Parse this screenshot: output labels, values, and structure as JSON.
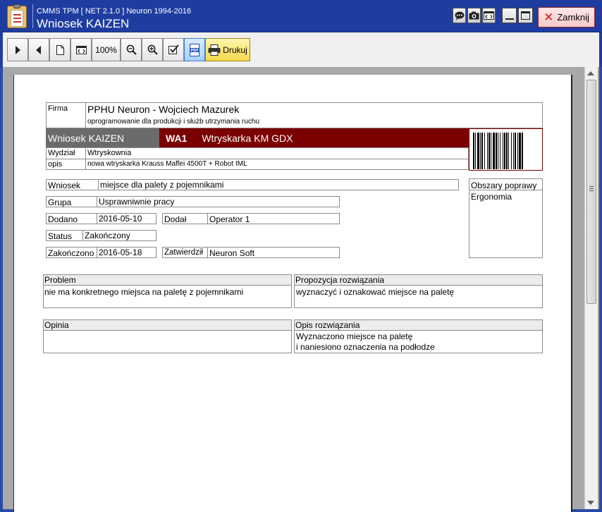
{
  "window": {
    "app_name": "CMMS TPM  [ NET 2.1.0 ]  Neuron 1994-2016",
    "title": "Wniosek KAIZEN",
    "close_label": "Zamknij"
  },
  "toolbar": {
    "zoom_label": "100%",
    "print_label": "Drukuj"
  },
  "report": {
    "firma_label": "Firma",
    "firma_name": "PPHU Neuron - Wojciech Mazurek",
    "firma_desc": "oprogramowanie dla produkcji i służb utrzymania ruchu",
    "doc_type": "Wniosek KAIZEN",
    "code": "WA1",
    "machine": "Wtryskarka KM GDX",
    "wydzial_label": "Wydział",
    "wydzial_value": "Wtryskownia",
    "opis_label": "opis",
    "opis_value": "nowa wtryskarka Krauss Maffei 4500T + Robot IML",
    "wniosek_label": "Wniosek",
    "wniosek_value": "miejsce dla palety z pojemnikami",
    "grupa_label": "Grupa",
    "grupa_value": "Usprawniwnie pracy",
    "dodano_label": "Dodano",
    "dodano_value": "2016-05-10",
    "dodal_label": "Dodał",
    "dodal_value": "Operator 1",
    "status_label": "Status",
    "status_value": "Zakończony",
    "zakonczono_label": "Zakończono",
    "zakonczono_value": "2016-05-18",
    "zatwierdzil_label": "Zatwierdził",
    "zatwierdzil_value": "Neuron Soft",
    "obszary_label": "Obszary poprawy",
    "obszary_value": "Ergonomia",
    "problem_label": "Problem",
    "problem_value": "nie ma konkretnego miejsca na paletę z pojemnikami",
    "propozycja_label": "Propozycja rozwiązania",
    "propozycja_value": "wyznaczyć i oznakować miejsce na paletę",
    "opinia_label": "Opinia",
    "opinia_value": "",
    "opis_rozw_label": "Opis rozwiązania",
    "opis_rozw_line1": "Wyznaczono miejsce na paletę",
    "opis_rozw_line2": "i naniesiono oznaczenia na podłodze"
  },
  "colors": {
    "titlebar": "#1f3da0",
    "band_gray": "#6b6b6b",
    "band_red": "#7b0000",
    "print_button": "#f5d84a"
  }
}
